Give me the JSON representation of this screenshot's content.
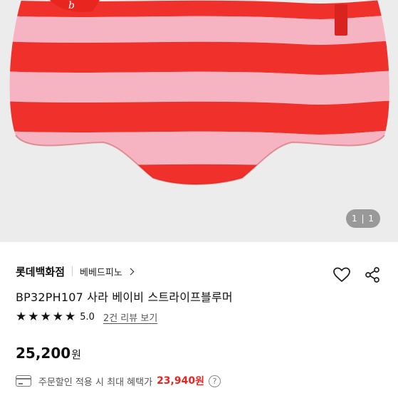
{
  "gallery": {
    "counter_current": "1",
    "counter_separator": "|",
    "counter_total": "1",
    "colors": {
      "stripe_red": "#f0302a",
      "stripe_pink": "#f6b3c1",
      "background": "#ececec"
    }
  },
  "product": {
    "brand": "롯데백화점",
    "sub_brand": "베베드피노",
    "title": "BP32PH107  사라 베이비 스트라이프블루머",
    "rating": {
      "stars": 5,
      "score": "5.0",
      "review_link": "2건 리뷰 보기"
    },
    "price": {
      "value": "25,200",
      "unit": "원"
    },
    "benefit": {
      "text": "주문할인 적용 시 최대 혜택가",
      "amount": "23,940",
      "unit": "원",
      "help": "?"
    }
  },
  "icons": [
    "heart-icon",
    "share-icon",
    "chevron-right-icon",
    "star-icon",
    "card-icon",
    "help-icon"
  ],
  "accent_color": "#e8251f"
}
